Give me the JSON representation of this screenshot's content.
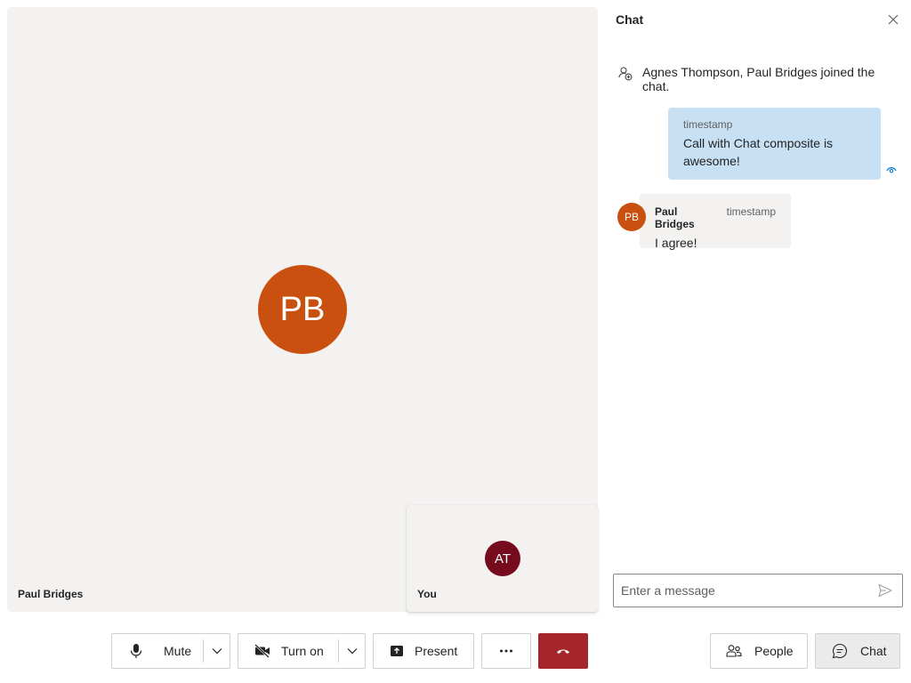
{
  "call": {
    "remote": {
      "initials": "PB",
      "name": "Paul Bridges",
      "avatar_color": "#ca5010"
    },
    "local": {
      "initials": "AT",
      "name": "You",
      "avatar_color": "#750b1c"
    }
  },
  "chat": {
    "title": "Chat",
    "system_message": "Agnes Thompson, Paul Bridges joined the chat.",
    "messages": [
      {
        "mine": true,
        "timestamp": "timestamp",
        "text": "Call with Chat composite is awesome!"
      },
      {
        "mine": false,
        "author": "Paul Bridges",
        "initials": "PB",
        "timestamp": "timestamp",
        "text": "I agree!"
      }
    ],
    "composer_placeholder": "Enter a message"
  },
  "controls": {
    "mute_label": "Mute",
    "camera_label": "Turn on",
    "present_label": "Present",
    "people_label": "People",
    "chat_label": "Chat"
  },
  "colors": {
    "accent": "#0078d4",
    "hangup": "#a4262c",
    "my_bubble": "#c7e0f4",
    "tile_bg": "#f3f2f1"
  }
}
